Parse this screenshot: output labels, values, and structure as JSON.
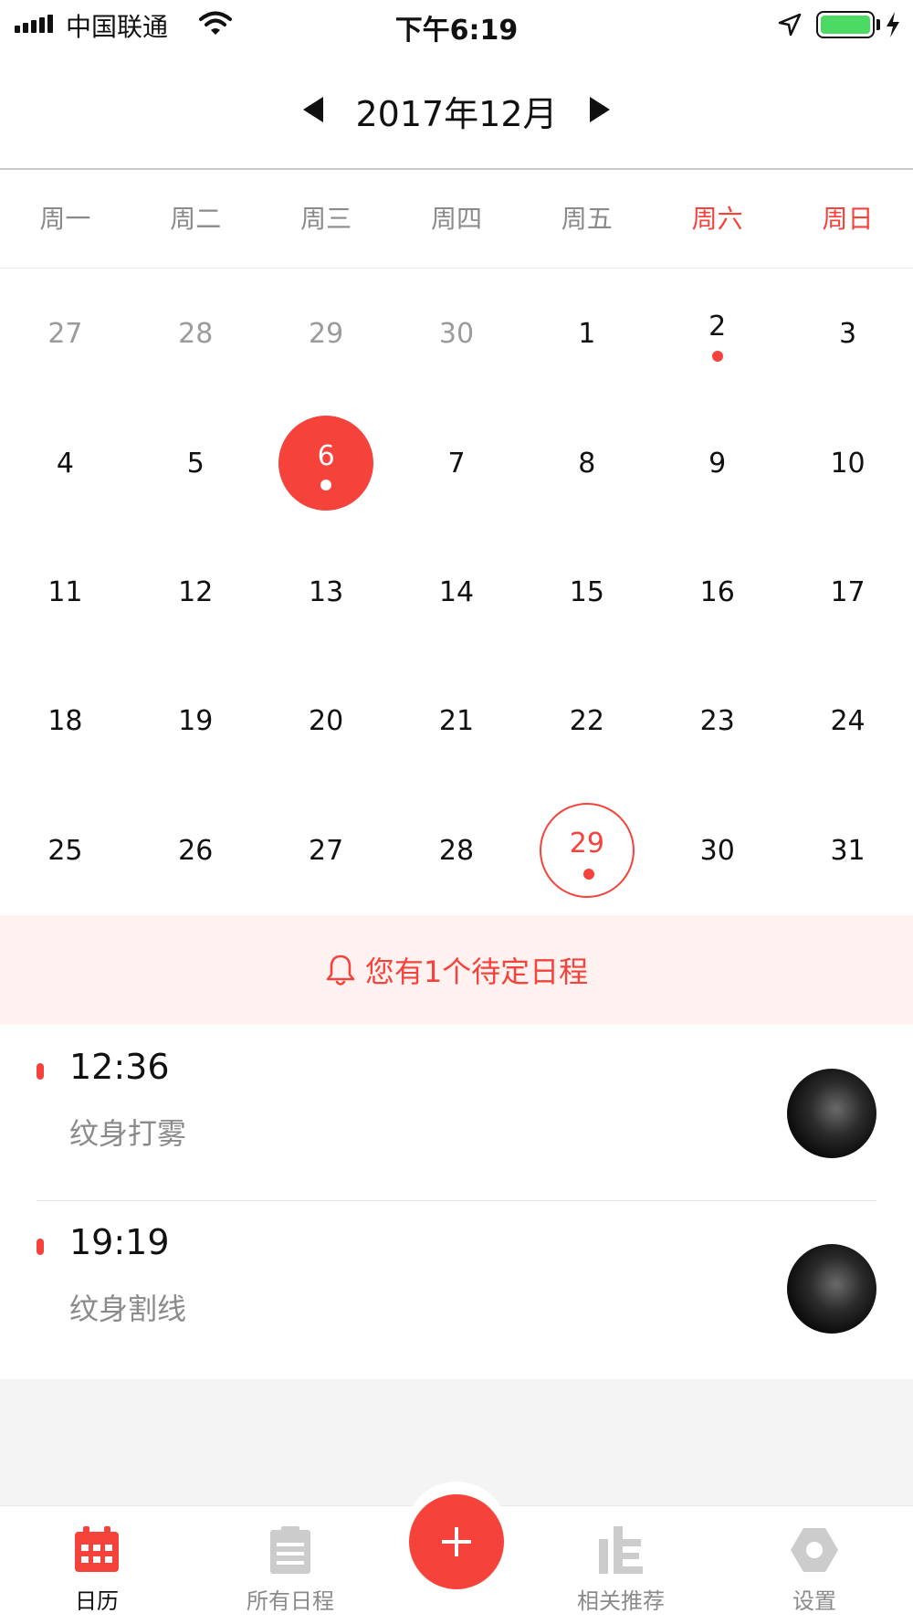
{
  "status_bar": {
    "carrier": "中国联通",
    "time": "下午6:19",
    "battery_color": "#4cd964"
  },
  "header": {
    "month_title": "2017年12月"
  },
  "weekdays": [
    "周一",
    "周二",
    "周三",
    "周四",
    "周五",
    "周六",
    "周日"
  ],
  "calendar": {
    "selected_day": "6",
    "today_day": "29",
    "weeks": [
      [
        {
          "d": "27",
          "other": true
        },
        {
          "d": "28",
          "other": true
        },
        {
          "d": "29",
          "other": true
        },
        {
          "d": "30",
          "other": true
        },
        {
          "d": "1"
        },
        {
          "d": "2",
          "dot": true
        },
        {
          "d": "3"
        }
      ],
      [
        {
          "d": "4"
        },
        {
          "d": "5"
        },
        {
          "d": "6",
          "selected": true,
          "dot": true
        },
        {
          "d": "7"
        },
        {
          "d": "8"
        },
        {
          "d": "9"
        },
        {
          "d": "10"
        }
      ],
      [
        {
          "d": "11"
        },
        {
          "d": "12"
        },
        {
          "d": "13"
        },
        {
          "d": "14"
        },
        {
          "d": "15"
        },
        {
          "d": "16"
        },
        {
          "d": "17"
        }
      ],
      [
        {
          "d": "18"
        },
        {
          "d": "19"
        },
        {
          "d": "20"
        },
        {
          "d": "21"
        },
        {
          "d": "22"
        },
        {
          "d": "23"
        },
        {
          "d": "24"
        }
      ],
      [
        {
          "d": "25"
        },
        {
          "d": "26"
        },
        {
          "d": "27"
        },
        {
          "d": "28"
        },
        {
          "d": "29",
          "today": true,
          "dot": true
        },
        {
          "d": "30"
        },
        {
          "d": "31"
        }
      ]
    ]
  },
  "pending_banner": {
    "text": "您有1个待定日程"
  },
  "events": [
    {
      "time": "12:36",
      "title": "纹身打雾"
    },
    {
      "time": "19:19",
      "title": "纹身割线"
    }
  ],
  "tabs": {
    "calendar": "日历",
    "all_events": "所有日程",
    "recommend": "相关推荐",
    "settings": "设置"
  },
  "colors": {
    "accent": "#f5433b",
    "banner_bg": "#fff2f1",
    "muted_text": "#8a8a8a",
    "tab_inactive": "#cccccc"
  }
}
